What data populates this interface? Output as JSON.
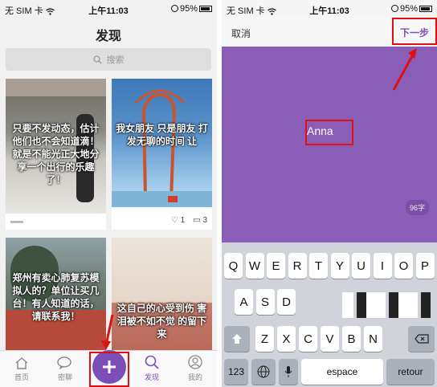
{
  "left": {
    "status": {
      "carrier": "无 SIM 卡",
      "time": "上午11:03",
      "battery": "95%"
    },
    "nav_title": "发现",
    "search_placeholder": "搜索",
    "cards": [
      {
        "caption": "只要不发动态，估计他们也不会知道滴！就是不能光正大地分享一个出行的乐趣了！"
      },
      {
        "caption": "我女朋友 只是朋友 打发无聊的时间 让",
        "likes": "1",
        "comments": "3"
      },
      {
        "caption": "郑州有卖心肺复苏模拟人的？单位让买几台！有人知道的话，请联系我！"
      },
      {
        "caption": "这自己的心受到伤 害泪被不如不觉 的留下来"
      }
    ],
    "tabs": [
      "首页",
      "密聊",
      "",
      "发现",
      "我的"
    ]
  },
  "right": {
    "status": {
      "carrier": "无 SIM 卡",
      "time": "上午11:03",
      "battery": "95%"
    },
    "cancel": "取消",
    "next": "下一步",
    "name": "Anna",
    "counter": "96字",
    "keys_row1": [
      "Q",
      "W",
      "E",
      "R",
      "T",
      "Y",
      "U",
      "I",
      "O",
      "P"
    ],
    "keys_row2": [
      "A",
      "S",
      "D"
    ],
    "keys_row3": [
      "Z",
      "X",
      "C",
      "V",
      "B",
      "N"
    ],
    "key_123": "123",
    "key_space": "espace",
    "key_return": "retour"
  },
  "colors": {
    "accent": "#7c4fb8",
    "canvas": "#8a5db6",
    "annotation": "#e01010"
  }
}
